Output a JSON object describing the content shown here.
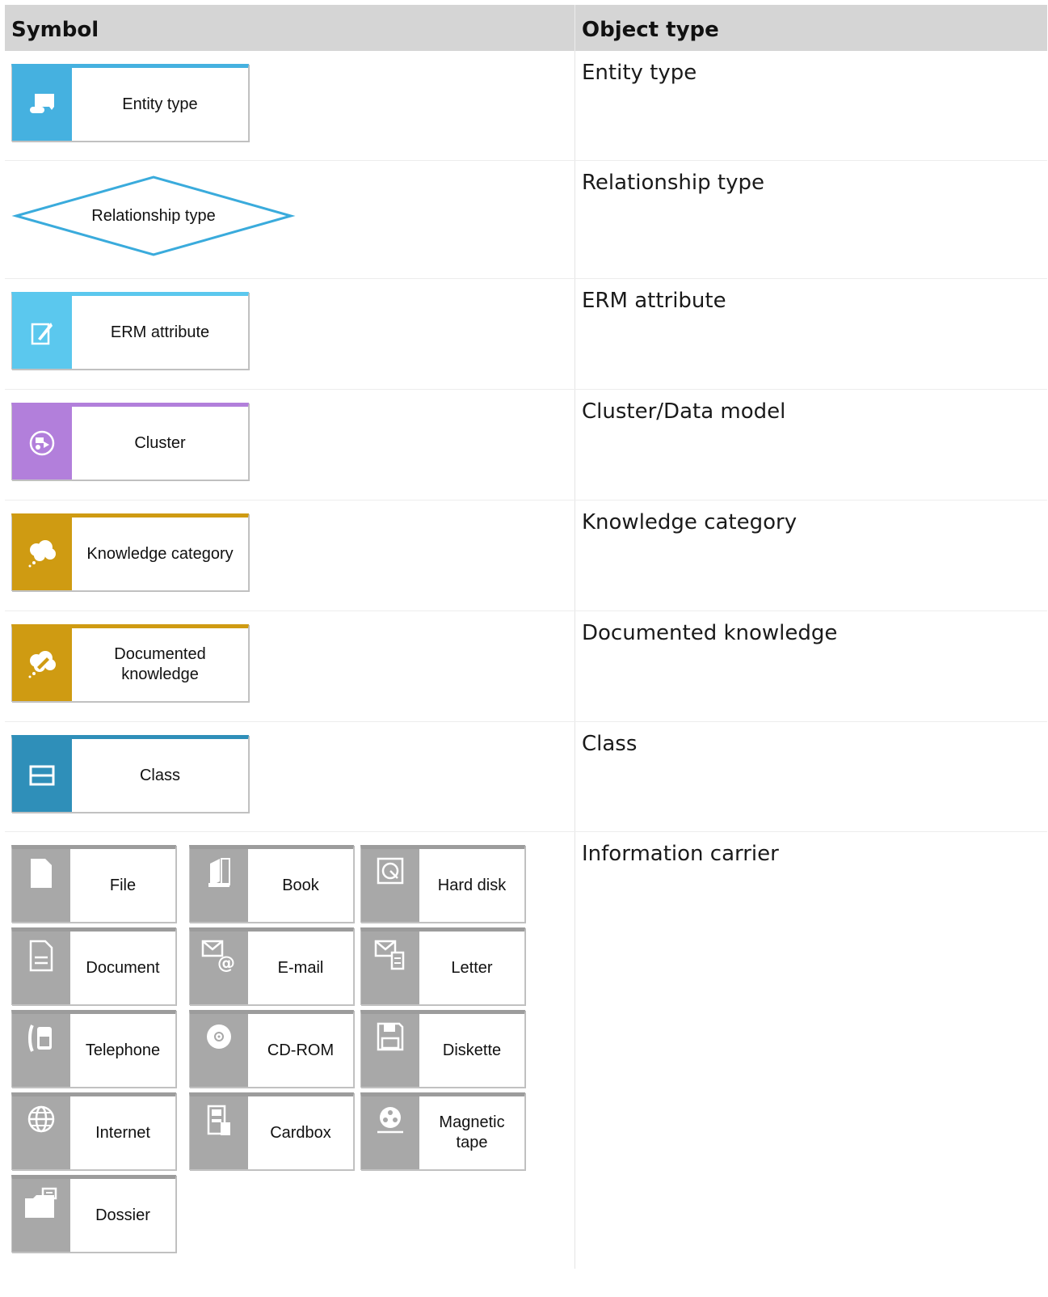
{
  "header": {
    "symbol": "Symbol",
    "object_type": "Object type"
  },
  "rows": [
    {
      "object_type": "Entity type",
      "symbol_label": "Entity type",
      "color": "#45b1e0",
      "icon": "entity-icon"
    },
    {
      "object_type": "Relationship type",
      "symbol_label": "Relationship type",
      "color": "#3aabdc",
      "icon": "diamond-shape"
    },
    {
      "object_type": "ERM attribute",
      "symbol_label": "ERM attribute",
      "color": "#5bc8ee",
      "icon": "attribute-icon"
    },
    {
      "object_type": "Cluster/Data model",
      "symbol_label": "Cluster",
      "color": "#b27fdb",
      "icon": "cluster-icon"
    },
    {
      "object_type": "Knowledge category",
      "symbol_label": "Knowledge category",
      "color": "#cf9b12",
      "icon": "cloud-icon"
    },
    {
      "object_type": "Documented knowledge",
      "symbol_label": "Documented knowledge",
      "color": "#cf9b12",
      "icon": "cloud-pencil-icon"
    },
    {
      "object_type": "Class",
      "symbol_label": "Class",
      "color": "#2f8fb9",
      "icon": "class-icon"
    },
    {
      "object_type": "Information carrier"
    }
  ],
  "carriers": [
    {
      "label": "File",
      "icon": "file-icon"
    },
    {
      "label": "Book",
      "icon": "book-icon"
    },
    {
      "label": "Hard disk",
      "icon": "hard-disk-icon"
    },
    {
      "label": "Document",
      "icon": "document-icon"
    },
    {
      "label": "E-mail",
      "icon": "email-icon"
    },
    {
      "label": "Letter",
      "icon": "letter-icon"
    },
    {
      "label": "Telephone",
      "icon": "telephone-icon"
    },
    {
      "label": "CD-ROM",
      "icon": "cd-rom-icon"
    },
    {
      "label": "Diskette",
      "icon": "diskette-icon"
    },
    {
      "label": "Internet",
      "icon": "globe-icon"
    },
    {
      "label": "Cardbox",
      "icon": "cardbox-icon"
    },
    {
      "label": "Magnetic tape",
      "icon": "magnetic-tape-icon"
    },
    {
      "label": "Dossier",
      "icon": "dossier-icon"
    }
  ]
}
